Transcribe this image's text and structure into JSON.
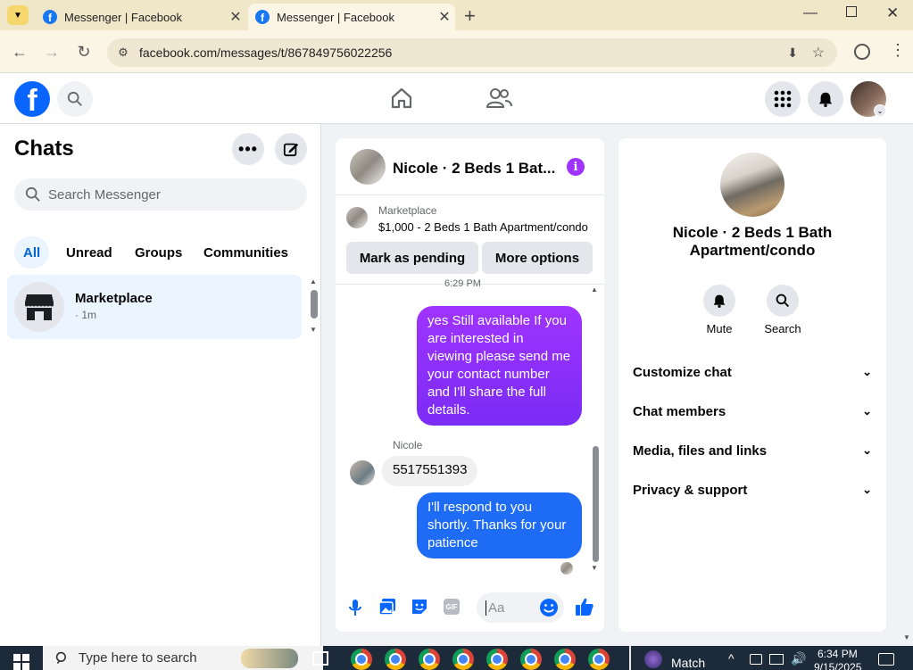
{
  "browser": {
    "tabs": [
      {
        "title": "Messenger | Facebook"
      },
      {
        "title": "Messenger | Facebook"
      }
    ],
    "url": "facebook.com/messages/t/867849756022256"
  },
  "chats": {
    "title": "Chats",
    "search_placeholder": "Search Messenger",
    "filters": [
      "All",
      "Unread",
      "Groups",
      "Communities"
    ],
    "items": [
      {
        "name": "Marketplace",
        "meta": "· 1m"
      }
    ]
  },
  "conversation": {
    "title": "Nicole · 2 Beds 1 Bat...",
    "marketplace_label": "Marketplace",
    "listing": "$1,000 - 2 Beds 1 Bath Apartment/condo",
    "mark_pending": "Mark as pending",
    "more_options": "More options",
    "timestamp": "6:29 PM",
    "messages": [
      {
        "from": "me",
        "text": "yes Still available If you are interested in viewing please send me your contact number and I'll share the full details."
      },
      {
        "from": "Nicole",
        "sender_label": "Nicole",
        "text": "5517551393"
      },
      {
        "from": "me",
        "text": "I'll respond to you shortly. Thanks for your patience"
      }
    ],
    "input_placeholder": "Aa"
  },
  "details": {
    "name": "Nicole · 2 Beds 1 Bath Apartment/condo",
    "mute_label": "Mute",
    "search_label": "Search",
    "sections": [
      "Customize chat",
      "Chat members",
      "Media, files and links",
      "Privacy & support"
    ]
  },
  "taskbar": {
    "search_placeholder": "Type here to search",
    "widget_label": "Match",
    "time": "6:34 PM",
    "date": "9/15/2025"
  },
  "colors": {
    "fb_blue": "#0866ff",
    "sent_bubble_purple": "#a033ff",
    "sent_bubble_blue": "#1e6cf5",
    "active_filter": "#0064d1",
    "info_icon": "#a033ff"
  }
}
